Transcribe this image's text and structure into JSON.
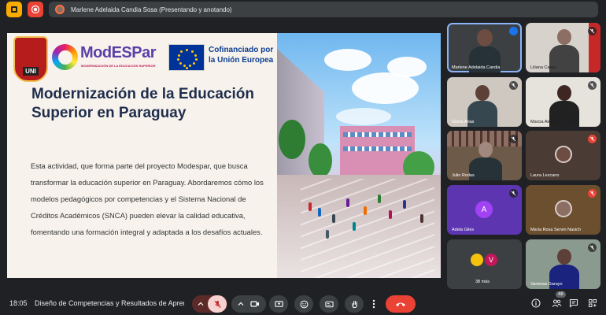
{
  "top_bar": {
    "presenter_label": "Marlene Adelaida Candia Sosa (Presentando y anotando)"
  },
  "slide": {
    "logo_uni_text": "UNI",
    "brand_name": "ModESPar",
    "brand_tagline": "MODERNIZACIÓN DE LA EDUCACIÓN SUPERIOR",
    "eu_line1": "Cofinanciado por",
    "eu_line2": "la Unión Europea",
    "title": "Modernización de la Educación Superior en Paraguay",
    "body": "Esta actividad, que forma parte del proyecto Modespar, que busca transformar la educación superior en Paraguay. Abordaremos cómo los modelos pedagógicos por competencias y el Sistema Nacional de Créditos Académicos (SNCA) pueden elevar la calidad educativa, fomentando una formación integral y adaptada a los desafíos actuales."
  },
  "participants": [
    {
      "name": "Marlene Adelaida Candia",
      "state": "speaking"
    },
    {
      "name": "Liliana Casas",
      "state": "muted"
    },
    {
      "name": "Gloria Arias",
      "state": "muted"
    },
    {
      "name": "Marcia Alejandra Geona",
      "state": "muted"
    },
    {
      "name": "Julio Rodas",
      "state": "muted"
    },
    {
      "name": "Laura Lezcano",
      "state": "muted"
    },
    {
      "name": "Adela Giles",
      "initial": "A",
      "state": "muted"
    },
    {
      "name": "María Rosa Servin Nasich",
      "state": "muted"
    },
    {
      "name": "38 más",
      "initial": "V",
      "state": "others"
    },
    {
      "name": "Vanessa Garayo",
      "state": "muted"
    }
  ],
  "bottom_bar": {
    "time": "18:05",
    "meeting_title": "Diseño de Competencias y Resultados de Aprendizaje",
    "participant_count": "48"
  },
  "colors": {
    "background": "#202124",
    "tile": "#3c4043",
    "end_call": "#ea4335",
    "title_navy": "#1f2d4d",
    "brand_purple": "#5b3fa8"
  }
}
